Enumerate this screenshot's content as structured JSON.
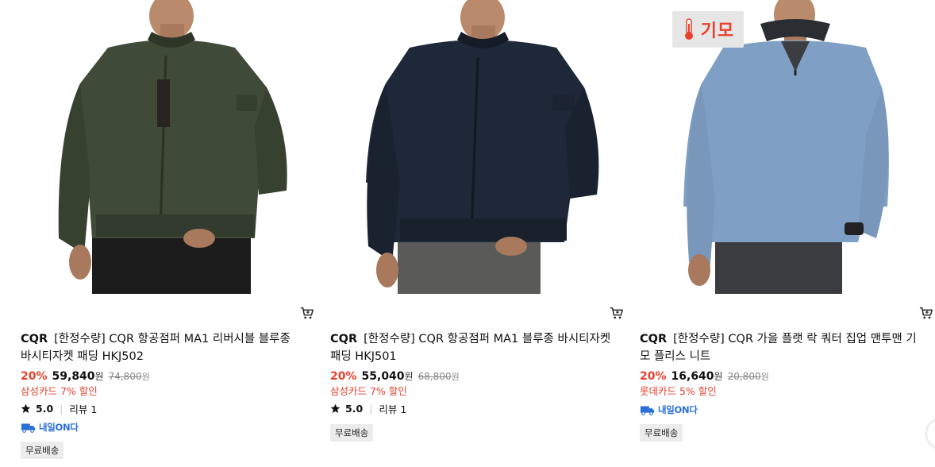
{
  "products": [
    {
      "brand": "CQR",
      "title": "[한정수량] CQR 항공점퍼 MA1 리버시블 블루종 바시티자켓 패딩 HKJ502",
      "discount": "20%",
      "price": "59,840",
      "price_unit": "원",
      "original_price": "74,800",
      "original_unit": "원",
      "card_discount": "삼성카드 7% 할인",
      "rating": "5.0",
      "review": "리뷰 1",
      "tomorrow_delivery": "내일ON다",
      "free_shipping": "무료배송",
      "jacket_color": "#3f4a39"
    },
    {
      "brand": "CQR",
      "title": "[한정수량] CQR 항공점퍼 MA1 블루종 바시티자켓 패딩 HKJ501",
      "discount": "20%",
      "price": "55,040",
      "price_unit": "원",
      "original_price": "68,800",
      "original_unit": "원",
      "card_discount": "삼성카드 7% 할인",
      "rating": "5.0",
      "review": "리뷰 1",
      "free_shipping": "무료배송",
      "jacket_color": "#1f2838"
    },
    {
      "brand": "CQR",
      "title": "[한정수량] CQR 가을 플랫 락 쿼터 집업 맨투맨 기모 플리스 니트",
      "discount": "20%",
      "price": "16,640",
      "price_unit": "원",
      "original_price": "20,800",
      "original_unit": "원",
      "card_discount": "롯데카드 5% 할인",
      "tomorrow_delivery": "내일ON다",
      "free_shipping": "무료배송",
      "badge": "기모",
      "jacket_color": "#7fa0c4"
    }
  ],
  "colors": {
    "accent": "#e8412c",
    "delivery_blue": "#2a6fd6"
  }
}
